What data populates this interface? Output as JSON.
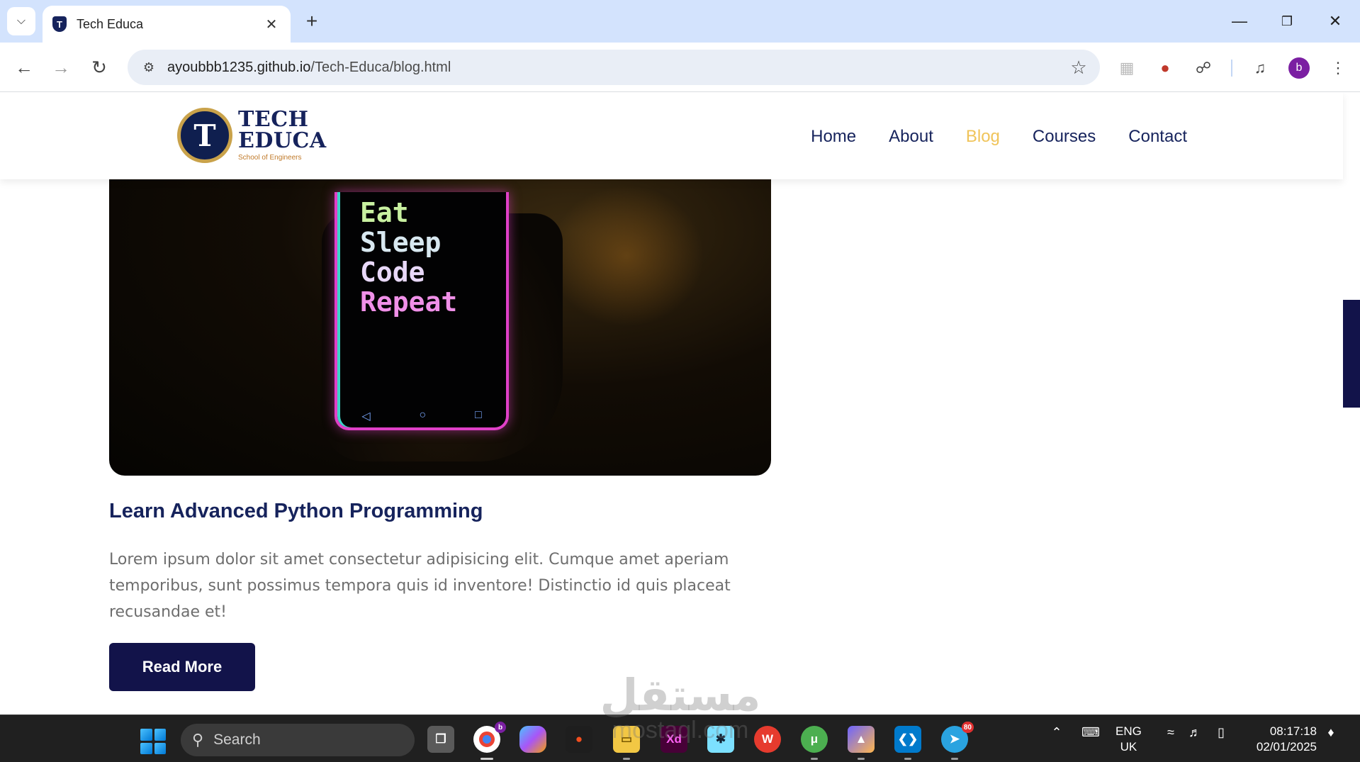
{
  "browser": {
    "tab_title": "Tech Educa",
    "tab_favicon_letter": "T",
    "url_host": "ayoubbb1235.github.io",
    "url_path": "/Tech-Educa/blog.html",
    "profile_initial": "b",
    "icons": {
      "tab_search": "chevron-down-icon",
      "close_tab": "close-icon",
      "new_tab": "plus-icon",
      "minimize": "minimize-icon",
      "restore": "restore-icon",
      "close_window": "close-icon",
      "back": "arrow-left-icon",
      "forward": "arrow-right-icon",
      "reload": "reload-icon",
      "site_info": "tune-icon",
      "bookmark": "star-icon",
      "extensions": "puzzle-icon",
      "media": "media-queue-icon",
      "menu": "kebab-menu-icon"
    }
  },
  "site": {
    "logo": {
      "badge_letter": "T",
      "line1": "TECH",
      "line2": "EDUCA",
      "tagline": "School of Engineers"
    },
    "nav": [
      {
        "label": "Home",
        "active": false
      },
      {
        "label": "About",
        "active": false
      },
      {
        "label": "Blog",
        "active": true
      },
      {
        "label": "Courses",
        "active": false
      },
      {
        "label": "Contact",
        "active": false
      }
    ],
    "colors": {
      "primary": "#16235c",
      "active_link": "#f0c45a",
      "button": "#12134a",
      "body_text": "#6e6e6e"
    }
  },
  "post": {
    "image_text": [
      "Eat",
      "Sleep",
      "Code",
      "Repeat"
    ],
    "title": "Learn Advanced Python Programming",
    "excerpt": "Lorem ipsum dolor sit amet consectetur adipisicing elit. Cumque amet aperiam temporibus, sunt possimus tempora quis id inventore! Distinctio id quis placeat recusandae et!",
    "button_label": "Read More"
  },
  "watermark": {
    "arabic": "مستقل",
    "latin": "mostaql.com"
  },
  "taskbar": {
    "search_label": "Search",
    "lang_line1": "ENG",
    "lang_line2": "UK",
    "time": "08:17:18",
    "date": "02/01/2025",
    "chrome_badge": "b",
    "telegram_badge": "80",
    "apps": [
      "task-view",
      "chrome",
      "copilot",
      "figma",
      "file-explorer",
      "adobe-xd",
      "asterisk-app",
      "wps-office",
      "utorrent",
      "photos",
      "vscode",
      "telegram"
    ]
  }
}
